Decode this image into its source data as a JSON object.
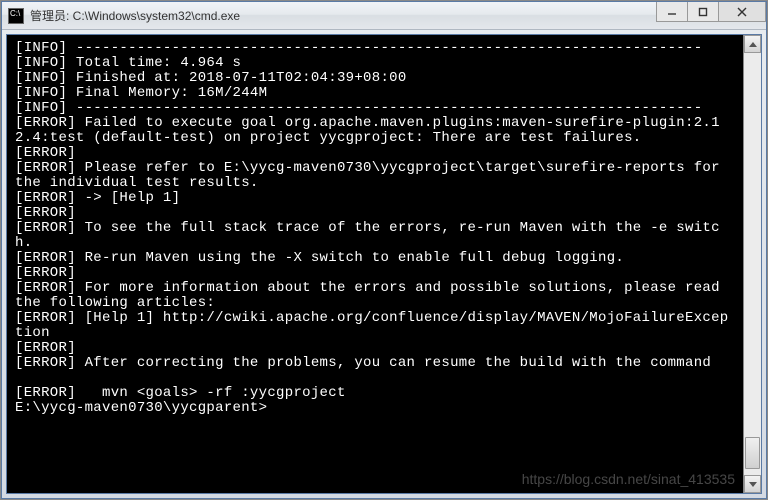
{
  "titlebar": {
    "icon_glyph": "C:\\",
    "title": "管理员: C:\\Windows\\system32\\cmd.exe"
  },
  "window_buttons": {
    "minimize": "minimize",
    "maximize": "maximize",
    "close": "close"
  },
  "console": {
    "lines": [
      "[INFO] ------------------------------------------------------------------------",
      "[INFO] Total time: 4.964 s",
      "[INFO] Finished at: 2018-07-11T02:04:39+08:00",
      "[INFO] Final Memory: 16M/244M",
      "[INFO] ------------------------------------------------------------------------",
      "[ERROR] Failed to execute goal org.apache.maven.plugins:maven-surefire-plugin:2.12.4:test (default-test) on project yycgproject: There are test failures.",
      "[ERROR]",
      "[ERROR] Please refer to E:\\yycg-maven0730\\yycgproject\\target\\surefire-reports for the individual test results.",
      "[ERROR] -> [Help 1]",
      "[ERROR]",
      "[ERROR] To see the full stack trace of the errors, re-run Maven with the -e switch.",
      "[ERROR] Re-run Maven using the -X switch to enable full debug logging.",
      "[ERROR]",
      "[ERROR] For more information about the errors and possible solutions, please read the following articles:",
      "[ERROR] [Help 1] http://cwiki.apache.org/confluence/display/MAVEN/MojoFailureException",
      "[ERROR]",
      "[ERROR] After correcting the problems, you can resume the build with the command",
      "",
      "[ERROR]   mvn <goals> -rf :yycgproject",
      "E:\\yycg-maven0730\\yycgparent>"
    ]
  },
  "watermark": "https://blog.csdn.net/sinat_413535"
}
